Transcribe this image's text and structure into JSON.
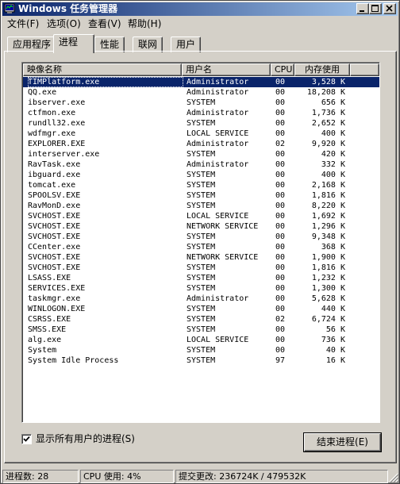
{
  "window": {
    "title": "Windows 任务管理器"
  },
  "menu": [
    "文件(F)",
    "选项(O)",
    "查看(V)",
    "帮助(H)"
  ],
  "tabs": [
    {
      "label": "应用程序",
      "active": false
    },
    {
      "label": "进程",
      "active": true
    },
    {
      "label": "性能",
      "active": false
    },
    {
      "label": "联网",
      "active": false
    },
    {
      "label": "用户",
      "active": false
    }
  ],
  "columns": {
    "name": "映像名称",
    "user": "用户名",
    "cpu": "CPU",
    "mem": "内存使用"
  },
  "processes": [
    {
      "name": "TIMPlatform.exe",
      "user": "Administrator",
      "cpu": "00",
      "mem": "3,528 K",
      "selected": true
    },
    {
      "name": "QQ.exe",
      "user": "Administrator",
      "cpu": "00",
      "mem": "18,208 K"
    },
    {
      "name": "ibserver.exe",
      "user": "SYSTEM",
      "cpu": "00",
      "mem": "656 K"
    },
    {
      "name": "ctfmon.exe",
      "user": "Administrator",
      "cpu": "00",
      "mem": "1,736 K"
    },
    {
      "name": "rundll32.exe",
      "user": "SYSTEM",
      "cpu": "00",
      "mem": "2,652 K"
    },
    {
      "name": "wdfmgr.exe",
      "user": "LOCAL SERVICE",
      "cpu": "00",
      "mem": "400 K"
    },
    {
      "name": "EXPLORER.EXE",
      "user": "Administrator",
      "cpu": "02",
      "mem": "9,920 K"
    },
    {
      "name": "interserver.exe",
      "user": "SYSTEM",
      "cpu": "00",
      "mem": "420 K"
    },
    {
      "name": "RavTask.exe",
      "user": "Administrator",
      "cpu": "00",
      "mem": "332 K"
    },
    {
      "name": "ibguard.exe",
      "user": "SYSTEM",
      "cpu": "00",
      "mem": "400 K"
    },
    {
      "name": "tomcat.exe",
      "user": "SYSTEM",
      "cpu": "00",
      "mem": "2,168 K"
    },
    {
      "name": "SPOOLSV.EXE",
      "user": "SYSTEM",
      "cpu": "00",
      "mem": "1,816 K"
    },
    {
      "name": "RavMonD.exe",
      "user": "SYSTEM",
      "cpu": "00",
      "mem": "8,220 K"
    },
    {
      "name": "SVCHOST.EXE",
      "user": "LOCAL SERVICE",
      "cpu": "00",
      "mem": "1,692 K"
    },
    {
      "name": "SVCHOST.EXE",
      "user": "NETWORK SERVICE",
      "cpu": "00",
      "mem": "1,296 K"
    },
    {
      "name": "SVCHOST.EXE",
      "user": "SYSTEM",
      "cpu": "00",
      "mem": "9,348 K"
    },
    {
      "name": "CCenter.exe",
      "user": "SYSTEM",
      "cpu": "00",
      "mem": "368 K"
    },
    {
      "name": "SVCHOST.EXE",
      "user": "NETWORK SERVICE",
      "cpu": "00",
      "mem": "1,900 K"
    },
    {
      "name": "SVCHOST.EXE",
      "user": "SYSTEM",
      "cpu": "00",
      "mem": "1,816 K"
    },
    {
      "name": "LSASS.EXE",
      "user": "SYSTEM",
      "cpu": "00",
      "mem": "1,232 K"
    },
    {
      "name": "SERVICES.EXE",
      "user": "SYSTEM",
      "cpu": "00",
      "mem": "1,300 K"
    },
    {
      "name": "taskmgr.exe",
      "user": "Administrator",
      "cpu": "00",
      "mem": "5,628 K"
    },
    {
      "name": "WINLOGON.EXE",
      "user": "SYSTEM",
      "cpu": "00",
      "mem": "440 K"
    },
    {
      "name": "CSRSS.EXE",
      "user": "SYSTEM",
      "cpu": "02",
      "mem": "6,724 K"
    },
    {
      "name": "SMSS.EXE",
      "user": "SYSTEM",
      "cpu": "00",
      "mem": "56 K"
    },
    {
      "name": "alg.exe",
      "user": "LOCAL SERVICE",
      "cpu": "00",
      "mem": "736 K"
    },
    {
      "name": "System",
      "user": "SYSTEM",
      "cpu": "00",
      "mem": "40 K"
    },
    {
      "name": "System Idle Process",
      "user": "SYSTEM",
      "cpu": "97",
      "mem": "16 K"
    }
  ],
  "show_all": {
    "label": "显示所有用户的进程(S)",
    "checked": true
  },
  "end_process_label": "结束进程(E)",
  "status": {
    "processes": "进程数: 28",
    "cpu": "CPU 使用: 4%",
    "commit": "提交更改: 236724K / 479532K"
  },
  "colors": {
    "face": "#d4d0c8",
    "title_start": "#0a246a",
    "title_end": "#a6caf0",
    "selection": "#0a246a"
  }
}
